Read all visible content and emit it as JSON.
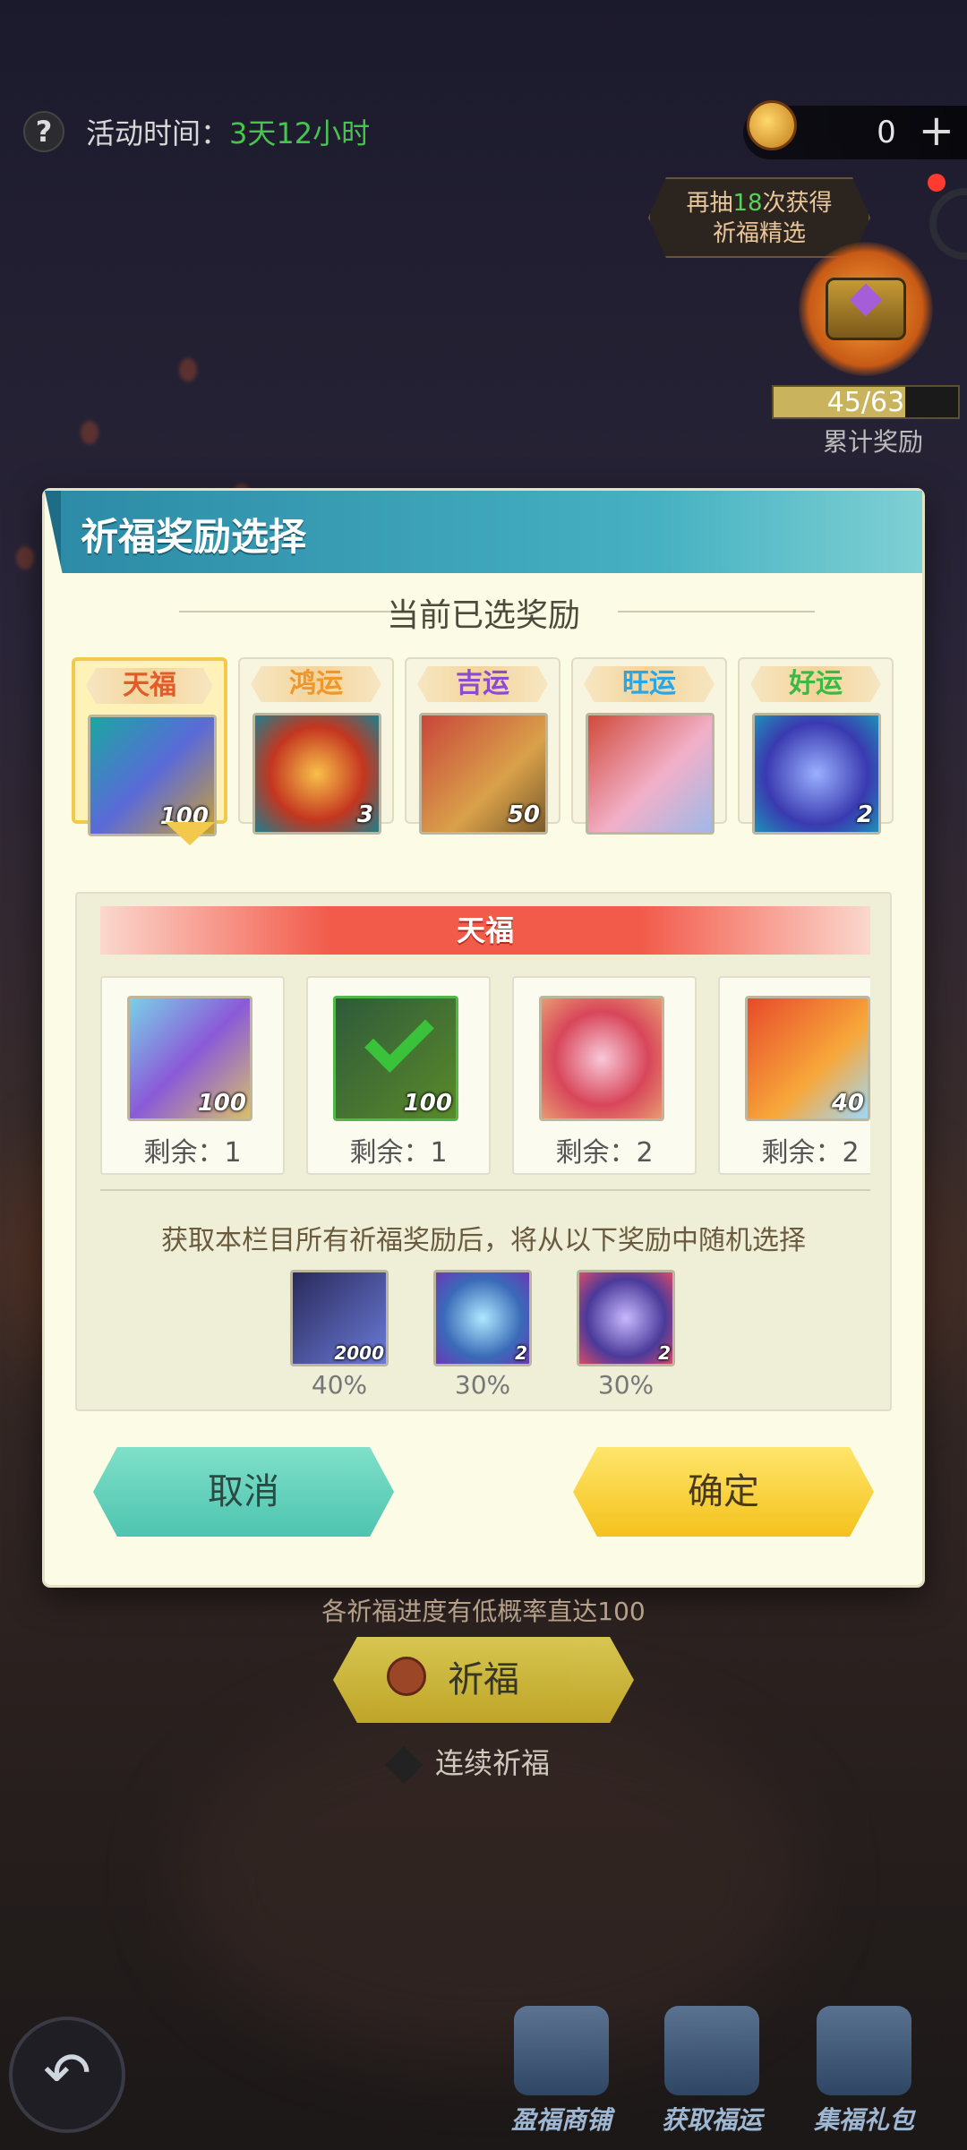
{
  "topbar": {
    "help_icon": "question-icon",
    "event_time_label": "活动时间：",
    "event_time_value": "3天12小时",
    "currency_count": "0",
    "currency_plus": "+",
    "draw_hint_pre": "再抽",
    "draw_hint_num": "18",
    "draw_hint_post": "次获得",
    "draw_hint_line2": "祈福精选",
    "cumulative_progress": "45/63",
    "cumulative_fraction": 0.714,
    "cumulative_label": "累计奖励"
  },
  "modal": {
    "title": "祈福奖励选择",
    "section_title": "当前已选奖励",
    "tiers": [
      {
        "label": "天福",
        "color": "#e25b2a",
        "qty": "100",
        "selected": true
      },
      {
        "label": "鸿运",
        "color": "#f0962a",
        "qty": "3"
      },
      {
        "label": "吉运",
        "color": "#8d4bd0",
        "qty": "50"
      },
      {
        "label": "旺运",
        "color": "#2aa5e5",
        "qty": ""
      },
      {
        "label": "好运",
        "color": "#3eb845",
        "qty": "2"
      }
    ],
    "active_tier": "天福",
    "pool": [
      {
        "qty": "100",
        "remain": "剩余：1",
        "checked": false
      },
      {
        "qty": "100",
        "remain": "剩余：1",
        "checked": true
      },
      {
        "qty": "",
        "remain": "剩余：2",
        "checked": false
      },
      {
        "qty": "40",
        "remain": "剩余：2",
        "checked": false
      }
    ],
    "random_note": "获取本栏目所有祈福奖励后，将从以下奖励中随机选择",
    "random_items": [
      {
        "qty": "2000",
        "pct": "40%"
      },
      {
        "qty": "2",
        "pct": "30%"
      },
      {
        "qty": "2",
        "pct": "30%"
      }
    ],
    "cancel_label": "取消",
    "confirm_label": "确定"
  },
  "background": {
    "hint": "各祈福进度有低概率直达100",
    "pray_label": "祈福",
    "auto_pray_label": "连续祈福",
    "back_icon": "back-arrow-icon",
    "nav": [
      {
        "label": "盈福商铺",
        "icon": "shop-icon"
      },
      {
        "label": "获取福运",
        "icon": "book-icon"
      },
      {
        "label": "集福礼包",
        "icon": "gift-icon"
      }
    ]
  }
}
